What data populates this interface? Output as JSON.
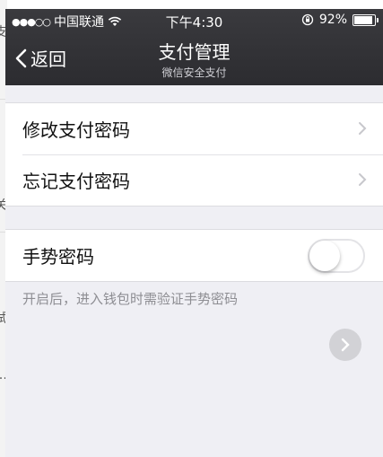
{
  "status_bar": {
    "carrier": "中国联通",
    "time": "下午4:30",
    "battery": "92%",
    "battery_level": 0.92
  },
  "nav": {
    "back_label": "返回",
    "title": "支付管理",
    "subtitle": "微信安全支付"
  },
  "menu": [
    {
      "label": "修改支付密码"
    },
    {
      "label": "忘记支付密码"
    }
  ],
  "gesture": {
    "label": "手势密码",
    "enabled": false,
    "hint": "开启后，进入钱包时需验证手势密码"
  },
  "background_page": {
    "edge_glyphs": [
      "支",
      "关",
      "试",
      "…"
    ]
  }
}
